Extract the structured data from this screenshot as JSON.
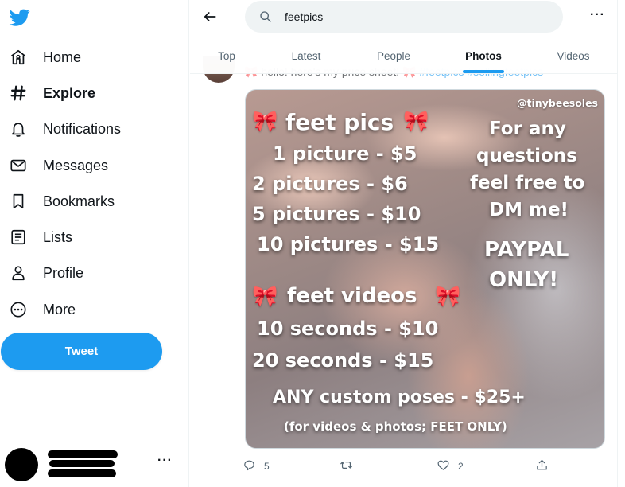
{
  "nav": {
    "items": [
      {
        "label": "Home",
        "icon": "home-icon"
      },
      {
        "label": "Explore",
        "icon": "hashtag-icon",
        "active": true
      },
      {
        "label": "Notifications",
        "icon": "bell-icon"
      },
      {
        "label": "Messages",
        "icon": "envelope-icon"
      },
      {
        "label": "Bookmarks",
        "icon": "bookmark-icon"
      },
      {
        "label": "Lists",
        "icon": "list-icon"
      },
      {
        "label": "Profile",
        "icon": "person-icon"
      },
      {
        "label": "More",
        "icon": "more-circle-icon"
      }
    ],
    "tweet_button": "Tweet"
  },
  "account": {
    "more": "···"
  },
  "search": {
    "value": "feetpics"
  },
  "topbar": {
    "more": "···"
  },
  "tabs": [
    {
      "label": "Top"
    },
    {
      "label": "Latest"
    },
    {
      "label": "People"
    },
    {
      "label": "Photos",
      "active": true
    },
    {
      "label": "Videos"
    }
  ],
  "tweet": {
    "text_before": "hello! here's my price sheet! ",
    "bow1": "🎀",
    "hashtag1": "#feetpics",
    "hashtag2": " #sellingfeetpics",
    "media": {
      "watermark": "@tinybeesoles",
      "heading1": "feet pics",
      "prices1": [
        "1 picture - $5",
        "2 pictures - $6",
        "5 pictures - $10",
        "10 pictures - $15"
      ],
      "side": [
        "For any",
        "questions",
        "feel free to",
        "DM me!"
      ],
      "paypal": [
        "PAYPAL",
        "ONLY!"
      ],
      "heading2": "feet videos",
      "prices2": [
        "10 seconds - $10",
        "20 seconds - $15"
      ],
      "custom": "ANY custom poses - $25+",
      "note": "(for videos & photos; FEET ONLY)",
      "bow": "🎀"
    },
    "actions": {
      "replies": "5",
      "retweets": "",
      "likes": "2"
    }
  },
  "colors": {
    "accent": "#1d9bf0",
    "text": "#0f1419",
    "muted": "#536471",
    "bow": "#ff7fb5"
  }
}
